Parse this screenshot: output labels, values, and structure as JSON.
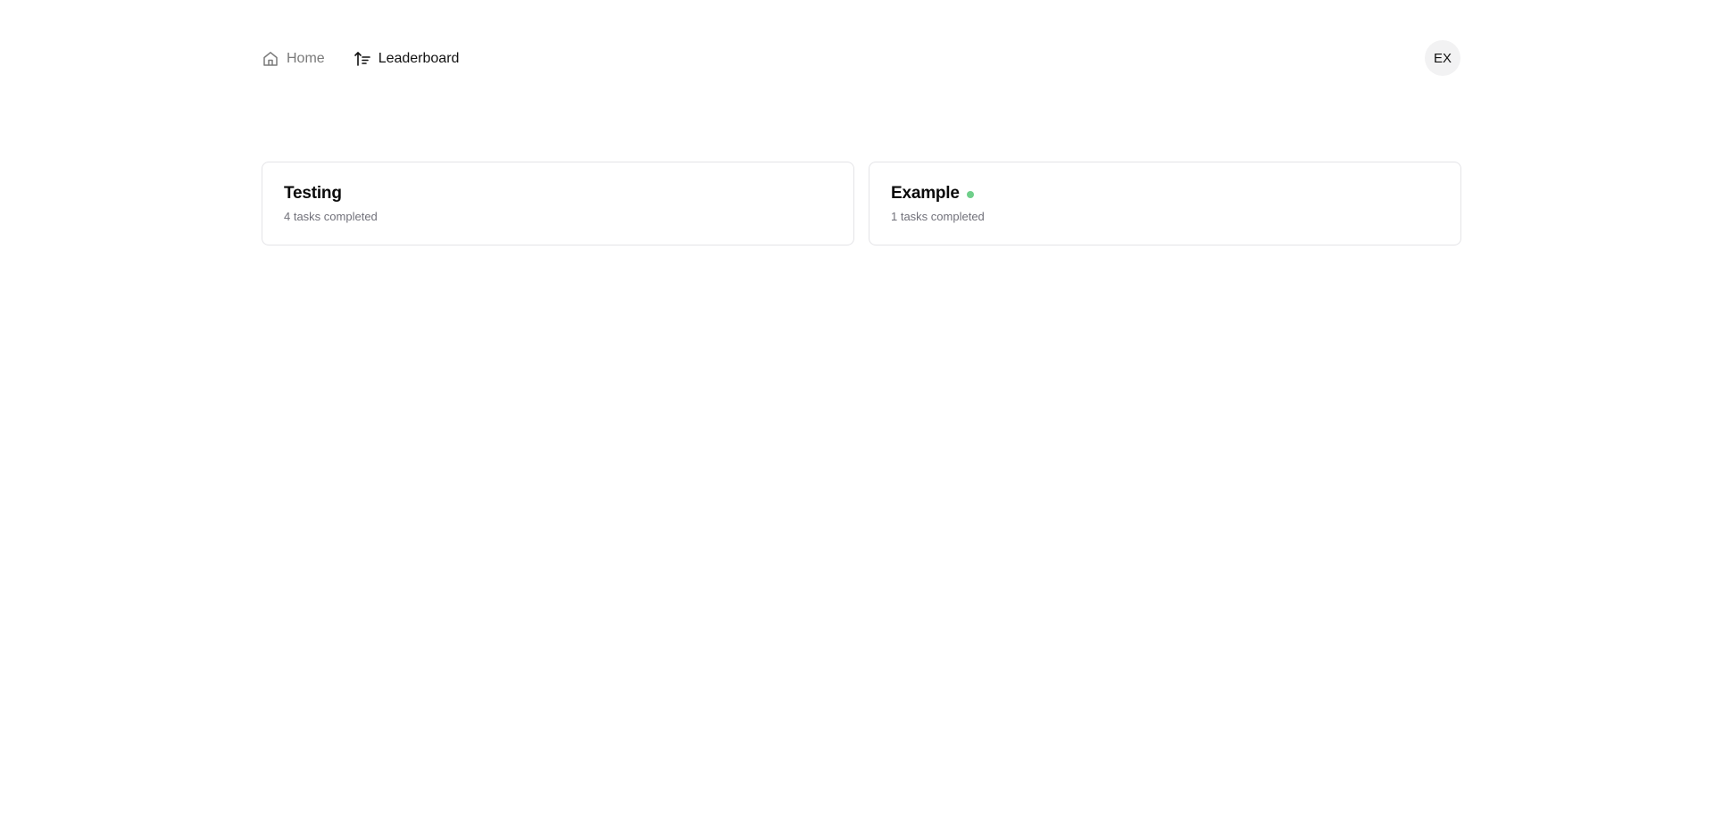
{
  "nav": {
    "items": [
      {
        "label": "Home",
        "icon": "home-icon",
        "active": false
      },
      {
        "label": "Leaderboard",
        "icon": "sort-ascending-icon",
        "active": true
      }
    ]
  },
  "user": {
    "initials": "EX"
  },
  "cards": [
    {
      "title": "Testing",
      "subtitle": "4 tasks completed",
      "online": false
    },
    {
      "title": "Example",
      "subtitle": "1 tasks completed",
      "online": true
    }
  ],
  "colors": {
    "online_dot": "#6fcf8a",
    "border": "#e4e4e7",
    "muted_text": "#71717a"
  }
}
